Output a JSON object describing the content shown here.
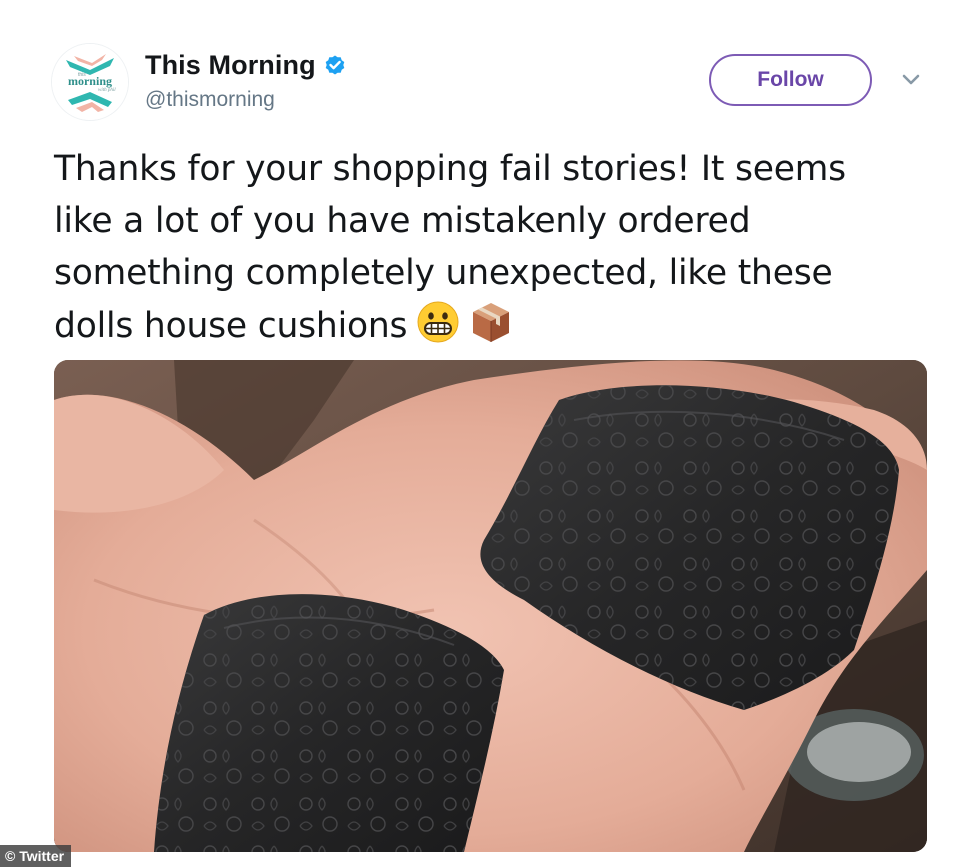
{
  "author": {
    "display_name": "This Morning",
    "handle": "@thismorning",
    "verified": true,
    "avatar_icon": "this-morning-logo"
  },
  "actions": {
    "follow_label": "Follow",
    "menu_icon": "chevron-down-icon"
  },
  "tweet": {
    "text_lines": [
      "Thanks for your shopping fail stories! It seems",
      "like a lot of you have mistakenly ordered",
      "something completely unexpected, like these",
      "dolls house cushions"
    ],
    "emojis": [
      "grimacing-face",
      "package"
    ]
  },
  "media": {
    "type": "photo"
  },
  "credit": "© Twitter",
  "colors": {
    "follow_accent": "#7d5bb5",
    "verified_badge": "#1da1f2",
    "handle_gray": "#657786"
  }
}
